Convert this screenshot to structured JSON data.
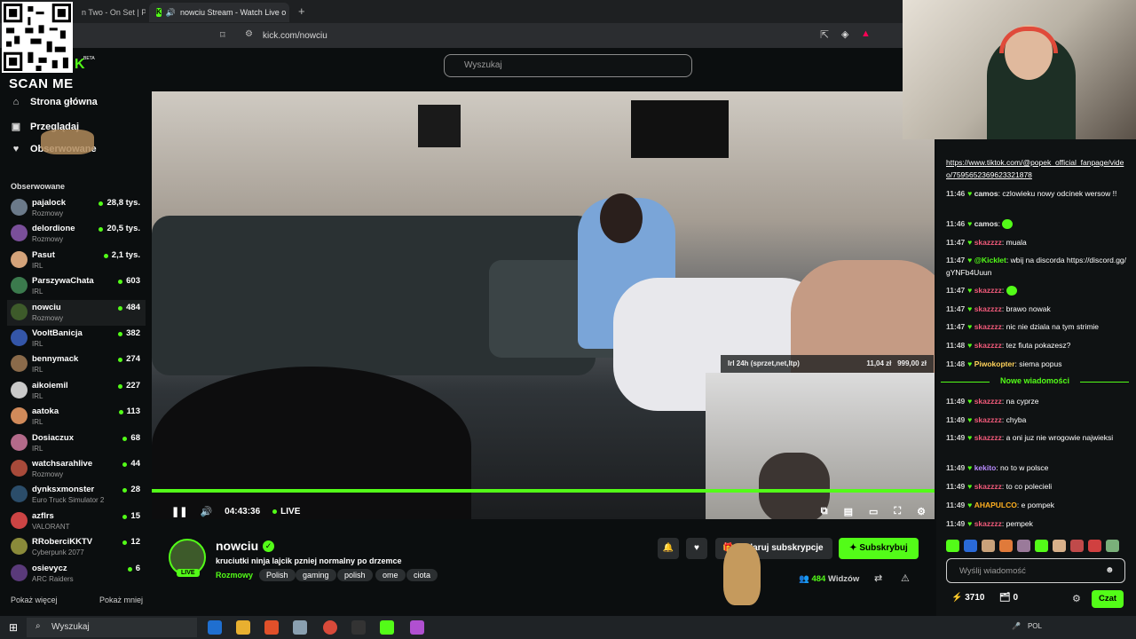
{
  "browser": {
    "tab1": "n Two - On Set | Prir",
    "tab2": "nowciu Stream - Watch Live o",
    "tab_close": "×",
    "new_tab": "+",
    "url": "kick.com/nowciu"
  },
  "overlay": {
    "scan_me": "SCAN ME",
    "beta": "BETA"
  },
  "search": {
    "placeholder": "Wyszukaj"
  },
  "nav": [
    {
      "label": "Strona główna",
      "icon": "home-icon"
    },
    {
      "label": "Przeglądaj",
      "icon": "browse-icon"
    },
    {
      "label": "Obserwowane",
      "icon": "following-icon"
    }
  ],
  "followed": {
    "heading": "Obserwowane",
    "channels": [
      {
        "name": "pajalock",
        "category": "Rozmowy",
        "viewers": "28,8 tys.",
        "color": "#6b7a8a"
      },
      {
        "name": "delordione",
        "category": "Rozmowy",
        "viewers": "20,5 tys.",
        "color": "#7a4f9a"
      },
      {
        "name": "Pasut",
        "category": "IRL",
        "viewers": "2,1 tys.",
        "color": "#d4a37a"
      },
      {
        "name": "ParszywaChata",
        "category": "IRL",
        "viewers": "603",
        "color": "#3b7a4d"
      },
      {
        "name": "nowciu",
        "category": "Rozmowy",
        "viewers": "484",
        "color": "#3d5a2a"
      },
      {
        "name": "VooltBanicja",
        "category": "IRL",
        "viewers": "382",
        "color": "#3456a8"
      },
      {
        "name": "bennymack",
        "category": "IRL",
        "viewers": "274",
        "color": "#8a6a4a"
      },
      {
        "name": "aikoiemil",
        "category": "IRL",
        "viewers": "227",
        "color": "#c9c9c9"
      },
      {
        "name": "aatoka",
        "category": "IRL",
        "viewers": "113",
        "color": "#d08a5a"
      },
      {
        "name": "Dosiaczux",
        "category": "IRL",
        "viewers": "68",
        "color": "#b36a8a"
      },
      {
        "name": "watchsarahlive",
        "category": "Rozmowy",
        "viewers": "44",
        "color": "#a84a3a"
      },
      {
        "name": "dynksxmonster",
        "category": "Euro Truck Simulator 2",
        "viewers": "28",
        "color": "#2b4d6a"
      },
      {
        "name": "azflrs",
        "category": "VALORANT",
        "viewers": "15",
        "color": "#c44"
      },
      {
        "name": "RRoberciKKTV",
        "category": "Cyberpunk 2077",
        "viewers": "12",
        "color": "#8a8a3a"
      },
      {
        "name": "osievycz",
        "category": "ARC Raiders",
        "viewers": "6",
        "color": "#5a3a7a"
      }
    ],
    "show_more": "Pokaż więcej",
    "show_less": "Pokaż mniej"
  },
  "player": {
    "goal_text": "Irl 24h (sprzet,net,ltp)",
    "goal_current": "11,04 zł",
    "goal_target": "999,00 zł",
    "time": "04:43:36",
    "live": "LIVE",
    "progress": 1.0
  },
  "stream": {
    "streamer": "nowciu",
    "live_badge": "LIVE",
    "title": "kruciutki ninja lajcik pzniej normalny po drzemce",
    "category": "Rozmowy",
    "tags": [
      "Polish",
      "gaming",
      "polish",
      "ome",
      "ciota"
    ],
    "gift_label": "Podaruj subskrypcje",
    "subscribe_label": "Subskrybuj",
    "viewers_count": "484",
    "viewers_label": "Widzów"
  },
  "chat": {
    "messages": [
      {
        "time": "",
        "user": "",
        "color": "#fff",
        "text": "https://www.tiktok.com/@popek_official_fanpage/video/7595652369623321878",
        "link": true
      },
      {
        "time": "11:46",
        "user": "camos",
        "color": "#e8e8e8",
        "text": "czlowieku nowy odcinek wersow !!"
      },
      {
        "time": "11:46",
        "user": "camos",
        "color": "#e8e8e8",
        "text": ""
      },
      {
        "time": "11:47",
        "user": "skazzzz",
        "color": "#f05a7a",
        "text": "muala"
      },
      {
        "time": "11:47",
        "user": "@Kicklet",
        "color": "#53fc18",
        "text": "wbij na discorda https://discord.gg/gYNFb4Uuun"
      },
      {
        "time": "11:47",
        "user": "skazzzz",
        "color": "#f05a7a",
        "text": ""
      },
      {
        "time": "11:47",
        "user": "skazzzz",
        "color": "#f05a7a",
        "text": "brawo nowak"
      },
      {
        "time": "11:47",
        "user": "skazzzz",
        "color": "#f05a7a",
        "text": "nic nie dziala na tym strimie"
      },
      {
        "time": "11:48",
        "user": "skazzzz",
        "color": "#f05a7a",
        "text": "tez fiuta pokazesz?"
      },
      {
        "time": "11:48",
        "user": "Piwokopter",
        "color": "#ffd25a",
        "text": "siema popus"
      },
      {
        "time": "11:49",
        "user": "skazzzz",
        "color": "#f05a7a",
        "text": "na cyprze"
      },
      {
        "time": "11:49",
        "user": "skazzzz",
        "color": "#f05a7a",
        "text": "chyba"
      },
      {
        "time": "11:49",
        "user": "skazzzz",
        "color": "#f05a7a",
        "text": "a oni juz nie wrogowie najwieksi"
      },
      {
        "time": "11:49",
        "user": "kekito",
        "color": "#b98cff",
        "text": "no to w polsce"
      },
      {
        "time": "11:49",
        "user": "skazzzz",
        "color": "#f05a7a",
        "text": "to co polecieli"
      },
      {
        "time": "11:49",
        "user": "AHAPULCO",
        "color": "#ffb020",
        "text": "e pompek"
      },
      {
        "time": "11:49",
        "user": "skazzzz",
        "color": "#f05a7a",
        "text": "pempek"
      }
    ],
    "new_messages": "Nowe wiadomości",
    "input_placeholder": "Wyślij wiadomość",
    "points": "3710",
    "rewards": "0",
    "chat_button": "Czat"
  },
  "taskbar": {
    "search": "Wyszukaj",
    "lang": "POL"
  },
  "colors": {
    "accent": "#53fc18",
    "bg": "#0b0e0f"
  }
}
